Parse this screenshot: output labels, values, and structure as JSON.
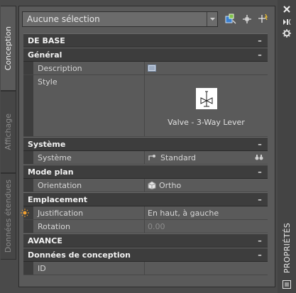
{
  "tabs": [
    {
      "label": "Conception",
      "active": true
    },
    {
      "label": "Affichage",
      "active": false
    },
    {
      "label": "Données étendues",
      "active": false
    }
  ],
  "palette_title": "PROPRIÉTÉS",
  "selection": {
    "value": "Aucune sélection"
  },
  "sections": {
    "base": {
      "label": "DE BASE",
      "toggle": "–"
    },
    "general": {
      "label": "Général",
      "toggle": "–"
    },
    "systeme": {
      "label": "Système",
      "toggle": "–"
    },
    "mode_plan": {
      "label": "Mode plan",
      "toggle": "–"
    },
    "emplacement": {
      "label": "Emplacement",
      "toggle": "–"
    },
    "avance": {
      "label": "AVANCE",
      "toggle": "–"
    },
    "donnees_conception": {
      "label": "Données de conception",
      "toggle": "–"
    }
  },
  "properties": {
    "description": {
      "name": "Description",
      "value": ""
    },
    "style": {
      "name": "Style",
      "value": "Valve - 3-Way Lever"
    },
    "systeme": {
      "name": "Système",
      "value": "Standard"
    },
    "orientation": {
      "name": "Orientation",
      "value": "Ortho"
    },
    "justification": {
      "name": "Justification",
      "value": "En haut, à gauche"
    },
    "rotation": {
      "name": "Rotation",
      "value": "0.00"
    },
    "id": {
      "name": "ID",
      "value": ""
    }
  },
  "colors": {
    "accent": "#e8a040",
    "section_bg": "#3d3d3d",
    "panel_bg": "#5a5a5a"
  }
}
